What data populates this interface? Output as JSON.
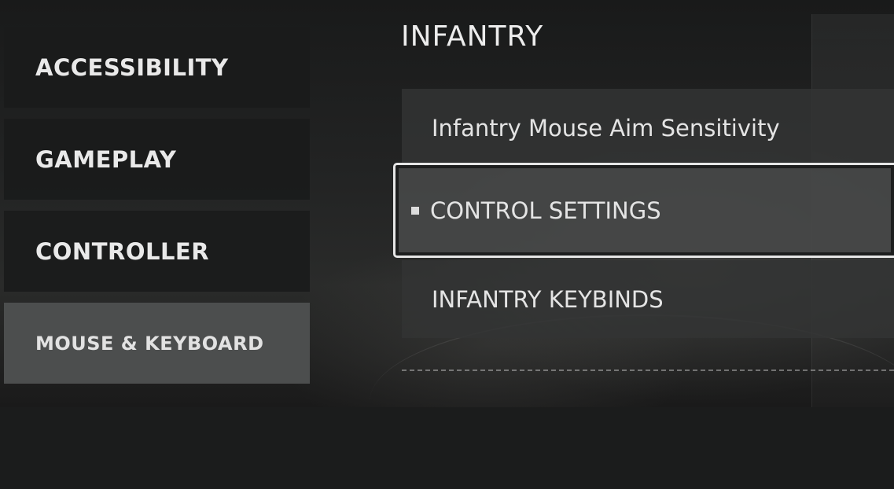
{
  "categories": [
    {
      "label": "ACCESSIBILITY",
      "active": false
    },
    {
      "label": "GAMEPLAY",
      "active": false
    },
    {
      "label": "CONTROLLER",
      "active": false
    },
    {
      "label": "MOUSE & KEYBOARD",
      "active": true
    }
  ],
  "section": {
    "title": "INFANTRY"
  },
  "settings": [
    {
      "label": "Infantry Mouse Aim Sensitivity",
      "selected": false
    },
    {
      "label": "CONTROL SETTINGS",
      "selected": true
    },
    {
      "label": "INFANTRY KEYBINDS",
      "selected": false
    }
  ],
  "colors": {
    "panel": "#1a1b1b",
    "active_panel": "#4c4e4e",
    "row": "#323434",
    "selection_border": "#e6e6e6",
    "text": "#e6e6e6"
  },
  "icons": {
    "selected_marker": "square-bullet-icon"
  }
}
